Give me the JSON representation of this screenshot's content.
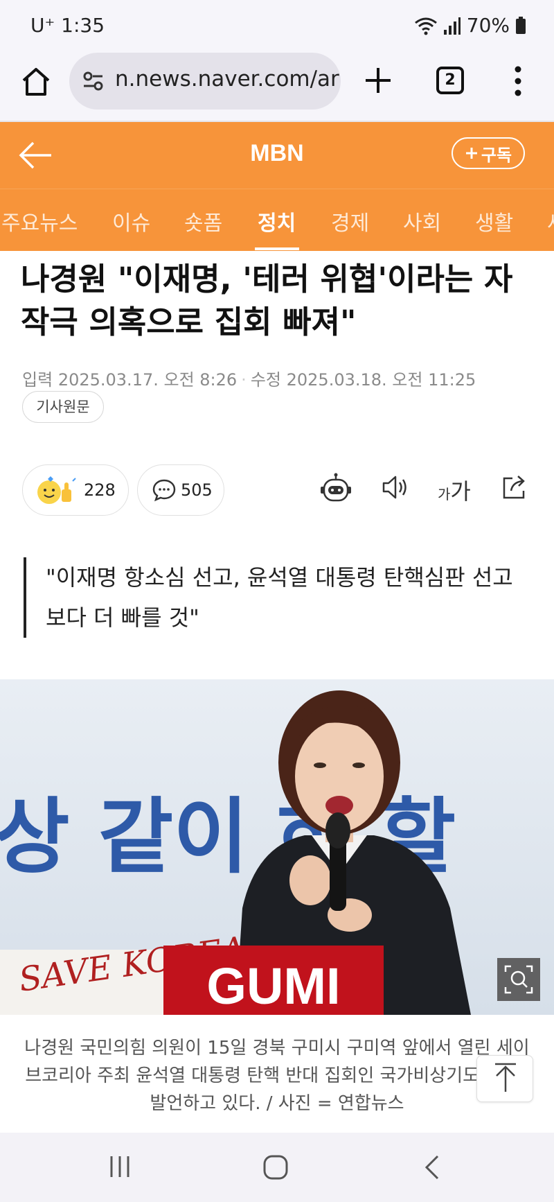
{
  "status_bar": {
    "carrier_time": "U⁺ 1:35",
    "battery": "70%"
  },
  "browser": {
    "url": "n.news.naver.com/ar",
    "tab_count": "2",
    "icons": [
      "home-icon",
      "site-settings-icon",
      "plus-icon",
      "tabs-icon",
      "more-vert-icon"
    ]
  },
  "header": {
    "title": "MBN",
    "subscribe_label": "구독",
    "accent_color": "#f7943a"
  },
  "categories": {
    "items": [
      "주요뉴스",
      "이슈",
      "숏폼",
      "정치",
      "경제",
      "사회",
      "생활",
      "세"
    ],
    "active": "정치"
  },
  "article": {
    "headline": "나경원 \"이재명, '테러 위협'이라는 자작극 의혹으로 집회 빠져\"",
    "input_label": "입력",
    "input_date": "2025.03.17. 오전 8:26",
    "edit_label": "수정",
    "edit_date": "2025.03.18. 오전 11:25",
    "original_button": "기사원문",
    "like_count": "228",
    "comment_count": "505",
    "font_size_label_small": "가",
    "font_size_label_large": "가",
    "subtitle": "\"이재명 항소심 선고, 윤석열 대통령 탄핵심판 선고보다 더 빠를 것\""
  },
  "photo": {
    "banner_text": "상 같이 하 할",
    "podium_text": "GUMI",
    "sign_text": "SAVE KOREA",
    "caption": "나경원 국민의힘 의원이 15일 경북 구미시 구미역 앞에서 열린 세이브코리아 주최 윤석열 대통령 탄핵 반대 집회인 국가비상기도회에서 발언하고 있다. / 사진 = 연합뉴스"
  }
}
